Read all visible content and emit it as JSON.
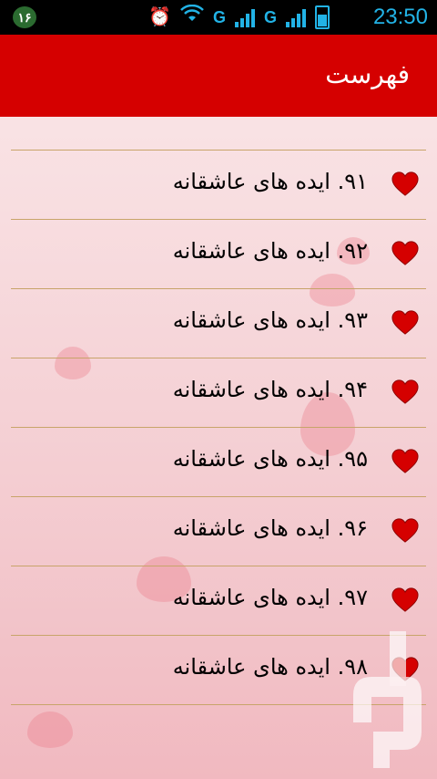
{
  "status_bar": {
    "notification_badge": "۱۶",
    "network_1": "G",
    "network_2": "G",
    "time": "23:50",
    "icons": [
      "alarm-icon",
      "wifi-icon",
      "signal-icon",
      "battery-icon"
    ]
  },
  "header": {
    "title": "فهرست",
    "color": "#d50000"
  },
  "list": {
    "items": [
      {
        "label": "۹۱.  ایده های عاشقانه",
        "icon": "heart-icon"
      },
      {
        "label": "۹۲.  ایده های عاشقانه",
        "icon": "heart-icon"
      },
      {
        "label": "۹۳.  ایده های عاشقانه",
        "icon": "heart-icon"
      },
      {
        "label": "۹۴.  ایده های عاشقانه",
        "icon": "heart-icon"
      },
      {
        "label": "۹۵.  ایده های عاشقانه",
        "icon": "heart-icon"
      },
      {
        "label": "۹۶.  ایده های عاشقانه",
        "icon": "heart-icon"
      },
      {
        "label": "۹۷.  ایده های عاشقانه",
        "icon": "heart-icon"
      },
      {
        "label": "۹۸.  ایده های عاشقانه",
        "icon": "heart-icon"
      }
    ],
    "heart_color": "#d50000",
    "divider_color": "#c8a46a"
  }
}
